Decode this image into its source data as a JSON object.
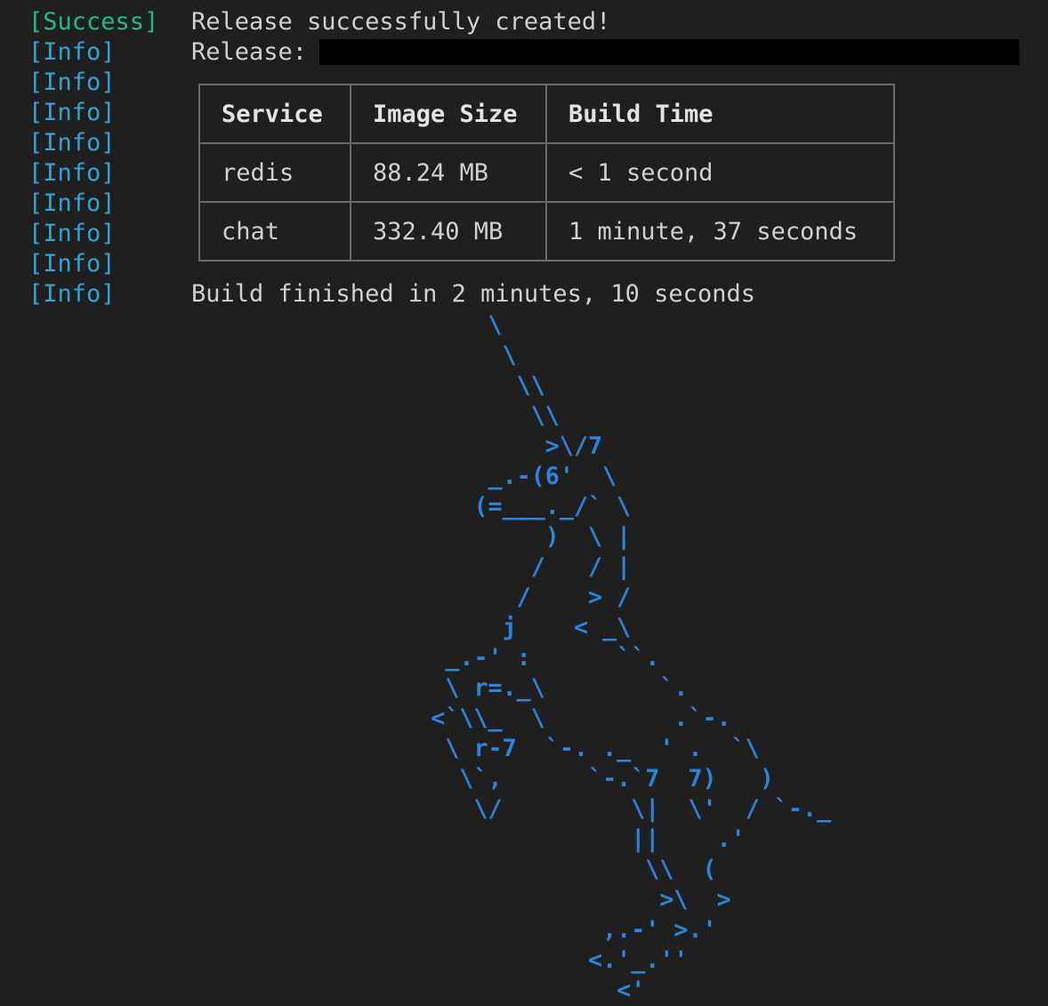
{
  "log": [
    {
      "tag": "[Success]",
      "kind": "success",
      "message": "Release successfully created!"
    },
    {
      "tag": "[Info]",
      "kind": "info",
      "message": "Release:"
    },
    {
      "tag": "[Info]",
      "kind": "info",
      "message": ""
    },
    {
      "tag": "[Info]",
      "kind": "info",
      "message": ""
    },
    {
      "tag": "[Info]",
      "kind": "info",
      "message": ""
    },
    {
      "tag": "[Info]",
      "kind": "info",
      "message": ""
    },
    {
      "tag": "[Info]",
      "kind": "info",
      "message": ""
    },
    {
      "tag": "[Info]",
      "kind": "info",
      "message": ""
    },
    {
      "tag": "[Info]",
      "kind": "info",
      "message": ""
    },
    {
      "tag": "[Info]",
      "kind": "info",
      "message": "Build finished in 2 minutes, 10 seconds"
    }
  ],
  "table": {
    "headers": [
      "Service",
      "Image Size",
      "Build Time"
    ],
    "rows": [
      [
        "redis",
        "88.24 MB",
        "< 1 second"
      ],
      [
        "chat",
        "332.40 MB",
        "1 minute, 37 seconds"
      ]
    ]
  },
  "art": {
    "name": "unicorn",
    "color": "#2b84dc",
    "text": "        \\\n         \\\n          \\\\\n           \\\\\n            >\\/7\n        _.-(6'  \\\n       (=___._/` \\\n            )  \\ |\n           /   / |\n          /    > /\n         j    < _\\\n     _.-' :      ``.\n     \\ r=._\\        `.\n    <`\\\\_  \\         .`-.\n     \\ r-7  `-. ._  ' .  `\\\n      \\`,      `-.`7  7)   )\n       \\/         \\|  \\'  / `-._\n                  ||    .'\n                   \\\\  (\n                    >\\  >\n                ,.-' >.'\n               <.'_.''\n                 <'"
  },
  "colors": {
    "background": "#1f1f1f",
    "text": "#d0d0d0",
    "success": "#23b98a",
    "info": "#2fa3d6",
    "art": "#2b84dc",
    "table_border": "#6a6a6a",
    "redaction": "#000000"
  }
}
